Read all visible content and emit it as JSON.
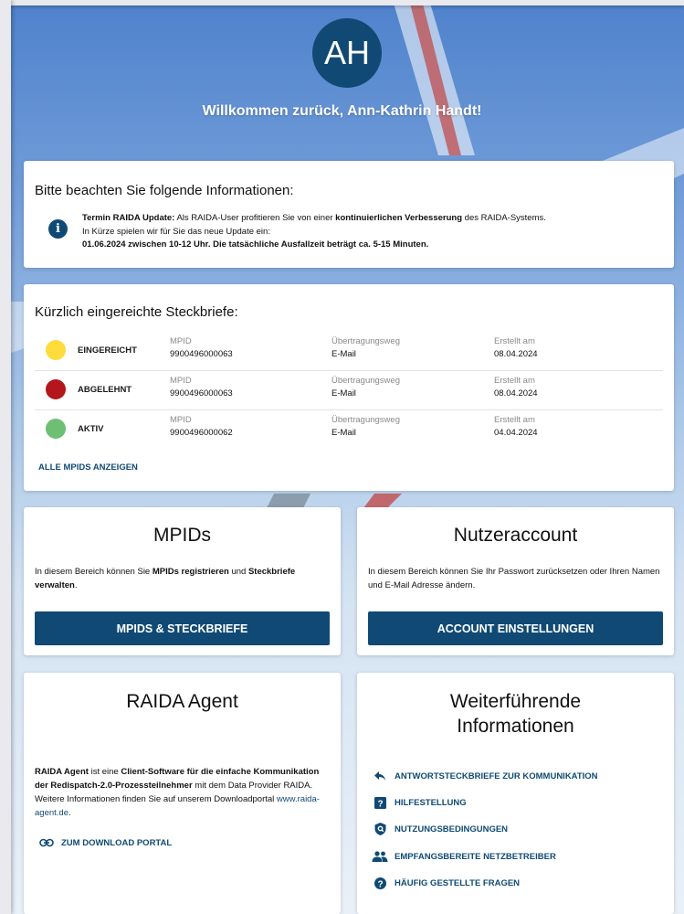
{
  "header": {
    "avatar_initials": "AH",
    "welcome": "Willkommen zurück, Ann-Kathrin Handt!"
  },
  "info": {
    "title": "Bitte beachten Sie folgende Informationen:",
    "line1_bold": "Termin RAIDA Update:",
    "line1_a": " Als RAIDA-User profitieren Sie von einer ",
    "line1_bold2": "kontinuierlichen Verbesserung",
    "line1_b": " des RAIDA-Systems.",
    "line2": "In Kürze spielen wir für Sie das neue Update ein:",
    "line3_bold": "01.06.2024 zwischen 10-12 Uhr. Die tatsächliche Ausfallzeit beträgt ca. 5-15 Minuten."
  },
  "steckbriefe": {
    "title": "Kürzlich eingereichte Steckbriefe:",
    "col_mpid": "MPID",
    "col_weg": "Übertragungsweg",
    "col_date": "Erstellt am",
    "rows": [
      {
        "status": "EINGEREICHT",
        "color": "#fddc3c",
        "mpid": "9900496000063",
        "weg": "E-Mail",
        "date": "08.04.2024"
      },
      {
        "status": "ABGELEHNT",
        "color": "#b3161b",
        "mpid": "9900496000063",
        "weg": "E-Mail",
        "date": "08.04.2024"
      },
      {
        "status": "AKTIV",
        "color": "#6cbf73",
        "mpid": "9900496000062",
        "weg": "E-Mail",
        "date": "04.04.2024"
      }
    ],
    "all_link": "ALLE MPIDS ANZEIGEN"
  },
  "mpids": {
    "title": "MPIDs",
    "text_a": "In diesem Bereich können Sie ",
    "text_bold1": "MPIDs registrieren",
    "text_b": " und ",
    "text_bold2": "Steckbriefe verwalten",
    "text_c": ".",
    "button": "MPIDS & STECKBRIEFE"
  },
  "account": {
    "title": "Nutzeraccount",
    "text": "In diesem Bereich können Sie Ihr Passwort zurücksetzen oder Ihren Namen und E-Mail Adresse ändern.",
    "button": "ACCOUNT EINSTELLUNGEN"
  },
  "agent": {
    "title": "RAIDA Agent",
    "text_bold1": "RAIDA Agent",
    "text_a": " ist eine ",
    "text_bold2": "Client-Software für die einfache Kommunikation der Redispatch-2.0-Prozessteilnehmer",
    "text_b": " mit dem Data Provider RAIDA. Weitere Informationen finden Sie auf unserem Downloadportal ",
    "text_link": "www.raida-agent.de",
    "text_c": ".",
    "download_link": "ZUM DOWNLOAD PORTAL"
  },
  "further": {
    "title_line1": "Weiterführende",
    "title_line2": "Informationen",
    "links": [
      {
        "label": "ANTWORTSTECKBRIEFE ZUR KOMMUNIKATION",
        "icon": "reply-icon"
      },
      {
        "label": "HILFESTELLUNG",
        "icon": "help-box-icon"
      },
      {
        "label": "NUTZUNGSBEDINGUNGEN",
        "icon": "shield-icon"
      },
      {
        "label": "EMPFANGSBEREITE NETZBETREIBER",
        "icon": "people-icon"
      },
      {
        "label": "HÄUFIG GESTELLTE FRAGEN",
        "icon": "question-circle-icon"
      }
    ]
  },
  "colors": {
    "primary": "#104a74"
  }
}
